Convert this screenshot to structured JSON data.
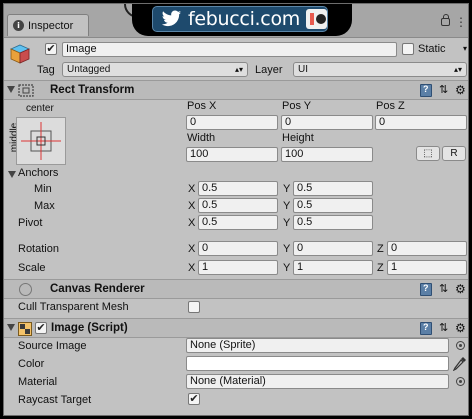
{
  "window": {
    "tab_label": "Inspector"
  },
  "watermark": {
    "text": "febucci.com"
  },
  "object": {
    "name": "Image",
    "active": true,
    "static_label": "Static",
    "static_checked": false,
    "tag_label": "Tag",
    "tag_value": "Untagged",
    "layer_label": "Layer",
    "layer_value": "UI"
  },
  "rect_transform": {
    "title": "Rect Transform",
    "anchor_h_label": "center",
    "anchor_v_label": "middle",
    "pos_x_label": "Pos X",
    "pos_y_label": "Pos Y",
    "pos_z_label": "Pos Z",
    "pos_x": "0",
    "pos_y": "0",
    "pos_z": "0",
    "width_label": "Width",
    "height_label": "Height",
    "width": "100",
    "height": "100",
    "raw_edit_label": "R",
    "anchors_label": "Anchors",
    "min_label": "Min",
    "max_label": "Max",
    "anchor_min_x": "0.5",
    "anchor_min_y": "0.5",
    "anchor_max_x": "0.5",
    "anchor_max_y": "0.5",
    "pivot_label": "Pivot",
    "pivot_x": "0.5",
    "pivot_y": "0.5",
    "rotation_label": "Rotation",
    "rotation_x": "0",
    "rotation_y": "0",
    "rotation_z": "0",
    "scale_label": "Scale",
    "scale_x": "1",
    "scale_y": "1",
    "scale_z": "1",
    "axis_x": "X",
    "axis_y": "Y",
    "axis_z": "Z"
  },
  "canvas_renderer": {
    "title": "Canvas Renderer",
    "cull_label": "Cull Transparent Mesh",
    "cull_checked": false
  },
  "image_script": {
    "title": "Image (Script)",
    "enabled": true,
    "source_image_label": "Source Image",
    "source_image_value": "None (Sprite)",
    "color_label": "Color",
    "color_value": "#ffffff",
    "material_label": "Material",
    "material_value": "None (Material)",
    "raycast_label": "Raycast Target",
    "raycast_checked": true
  },
  "colors": {
    "panel_bg": "#c2c2c2",
    "header_bg": "#bababa",
    "field_bg": "#f0f0f0",
    "watermark_bg": "#1e4a6d"
  }
}
